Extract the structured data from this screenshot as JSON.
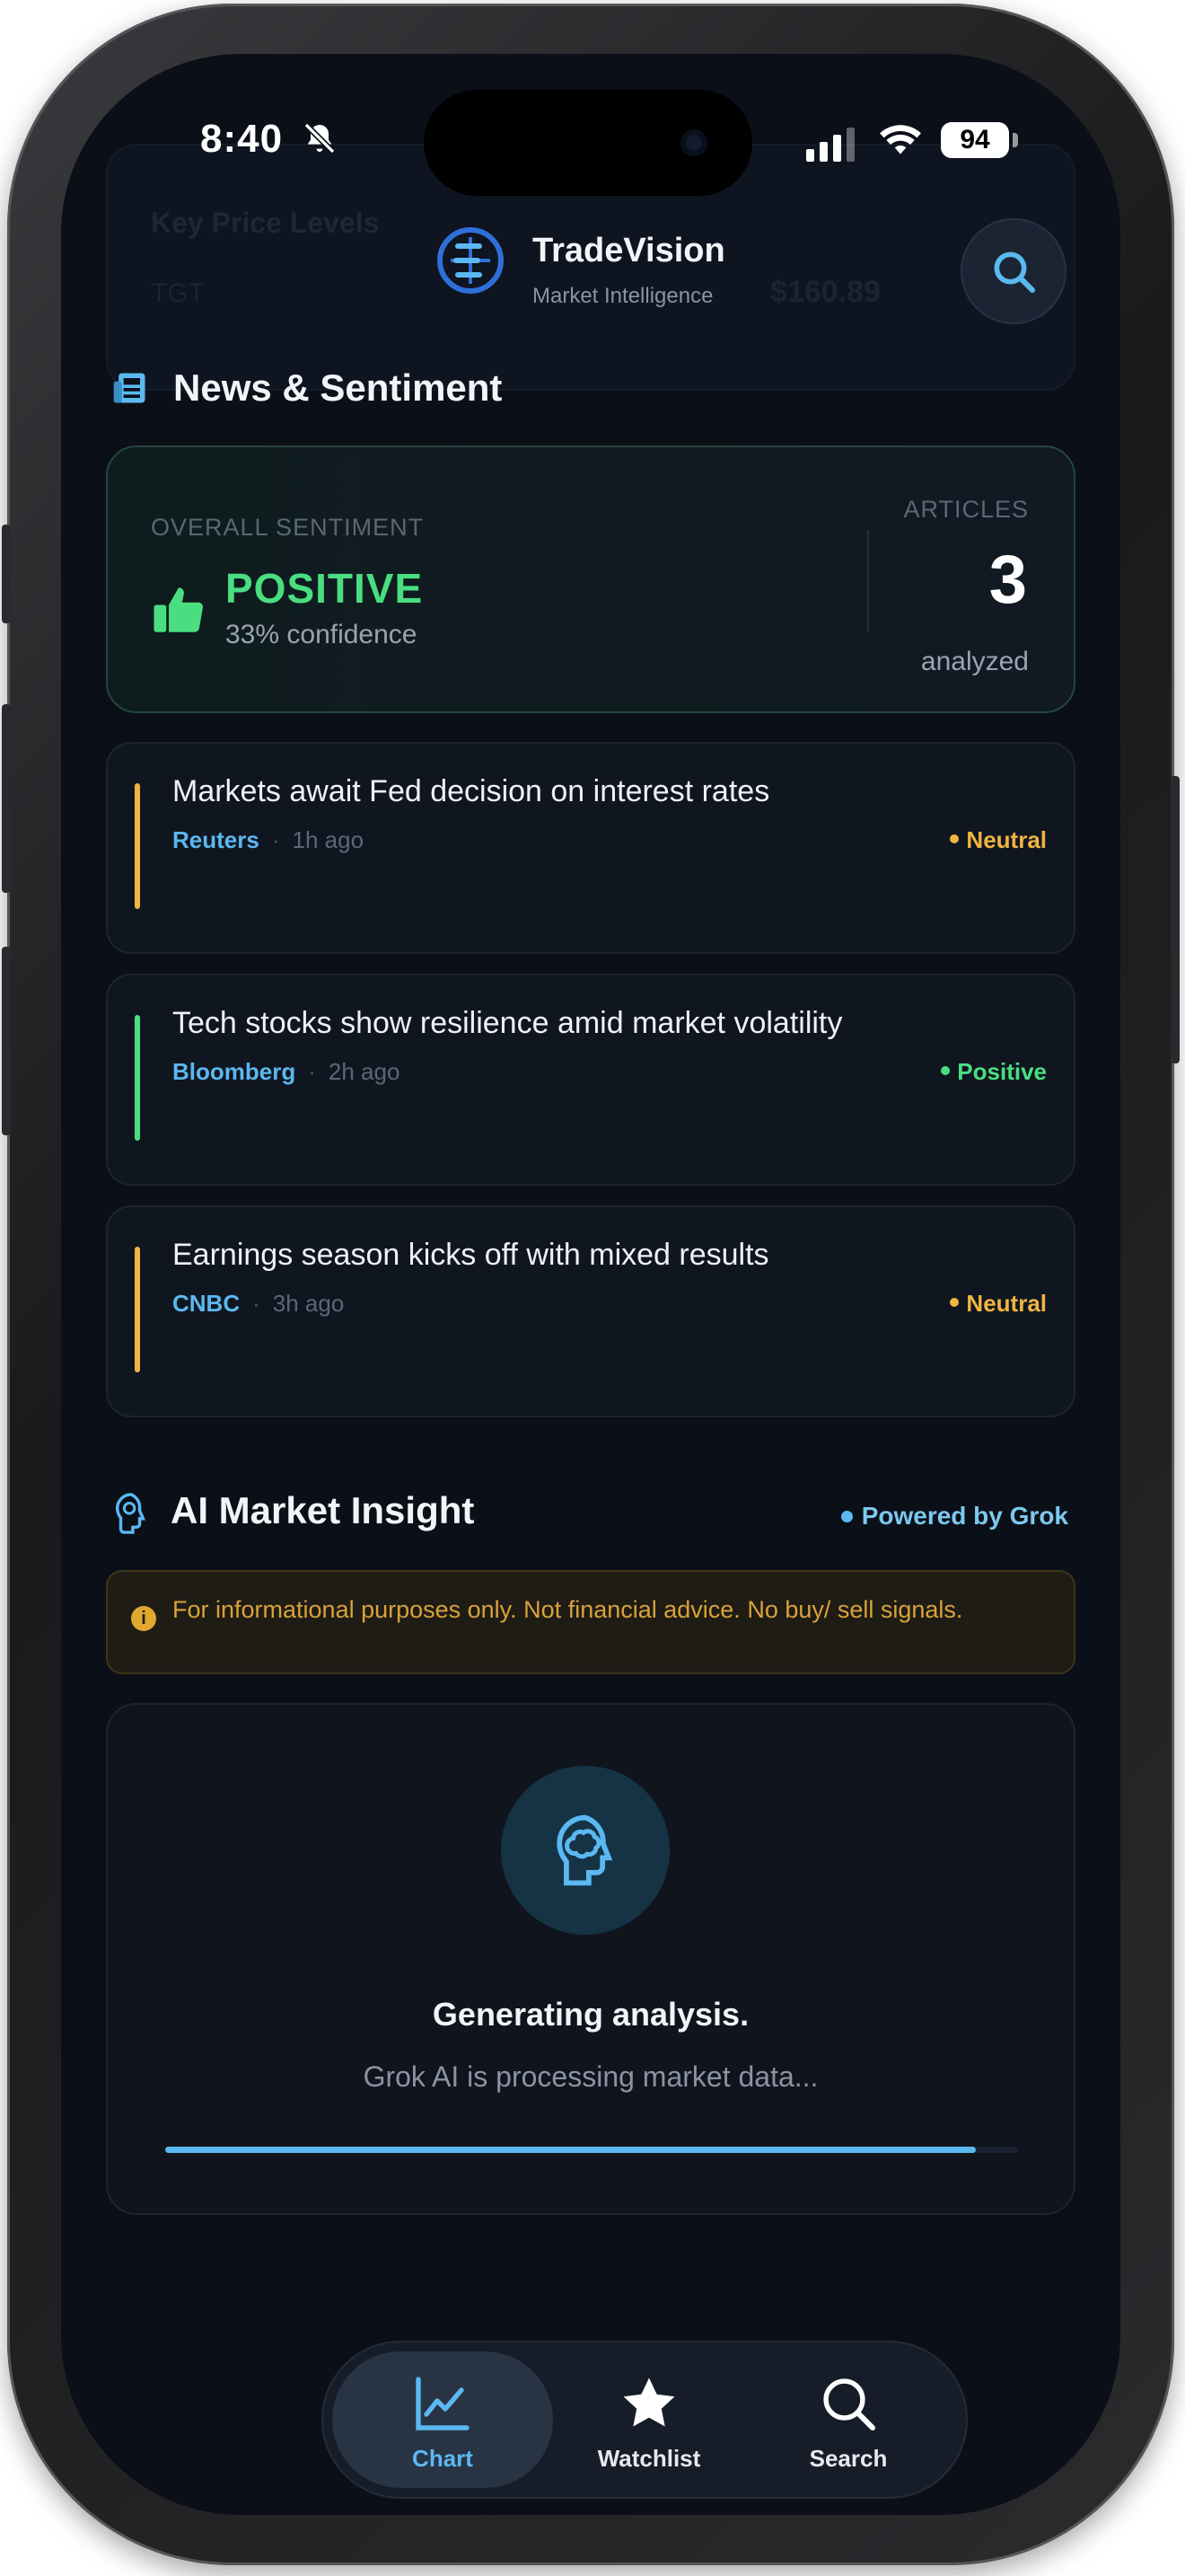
{
  "status_bar": {
    "time": "8:40",
    "battery": "94"
  },
  "ghost": {
    "title": "Key Price Levels",
    "row_label": "TGT",
    "row_value": "$160.89"
  },
  "header": {
    "app_name": "TradeVision",
    "subtitle": "Market Intelligence"
  },
  "news_section": {
    "title": "News & Sentiment"
  },
  "summary": {
    "overall_label": "OVERALL SENTIMENT",
    "sentiment": "POSITIVE",
    "confidence": "33% confidence",
    "articles_label": "ARTICLES",
    "articles_count": "3",
    "articles_sub": "analyzed"
  },
  "news": [
    {
      "title": "Markets await Fed decision on interest rates",
      "source": "Reuters",
      "sep": "·",
      "time": "1h ago",
      "sentiment": "Neutral",
      "color": "#f0b440"
    },
    {
      "title": "Tech stocks show resilience amid market volatility",
      "source": "Bloomberg",
      "sep": "·",
      "time": "2h ago",
      "sentiment": "Positive",
      "color": "#4ade80"
    },
    {
      "title": "Earnings season kicks off with mixed results",
      "source": "CNBC",
      "sep": "·",
      "time": "3h ago",
      "sentiment": "Neutral",
      "color": "#f0b440"
    }
  ],
  "ai_section": {
    "title": "AI Market Insight",
    "powered_by": "Powered by Grok",
    "disclaimer": "For informational purposes only. Not financial advice. No buy/ sell signals.",
    "generating_title": "Generating analysis.",
    "generating_sub": "Grok AI is processing market data...",
    "progress": 0.95
  },
  "tabs": [
    {
      "label": "Chart",
      "icon": "chart-icon",
      "active": true
    },
    {
      "label": "Watchlist",
      "icon": "star-icon",
      "active": false
    },
    {
      "label": "Search",
      "icon": "search-icon",
      "active": false
    }
  ],
  "colors": {
    "accent": "#5bb8f0",
    "positive": "#4ade80",
    "neutral": "#f0b440",
    "background": "#0b0f18"
  }
}
